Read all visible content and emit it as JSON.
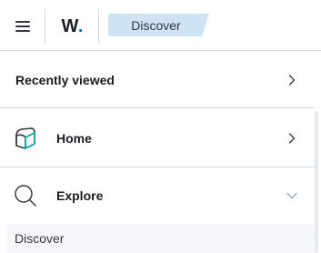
{
  "header": {
    "menu_icon": "hamburger-menu-icon",
    "logo": {
      "letter": "W",
      "dot": "."
    },
    "breadcrumb": "Discover"
  },
  "nav": {
    "recently_viewed": {
      "label": "Recently viewed",
      "icon": "chevron-right-icon"
    },
    "home": {
      "label": "Home",
      "icon": "home-cube-icon",
      "chevron": "chevron-right-icon"
    },
    "explore": {
      "label": "Explore",
      "icon": "search-icon",
      "chevron": "chevron-down-icon",
      "expanded": true
    },
    "explore_items": [
      {
        "label": "Discover"
      }
    ]
  },
  "colors": {
    "accent": "#0077cc",
    "breadcrumb_bg": "#cfe3f3",
    "border": "#d3dae6",
    "text": "#1a1c21"
  }
}
